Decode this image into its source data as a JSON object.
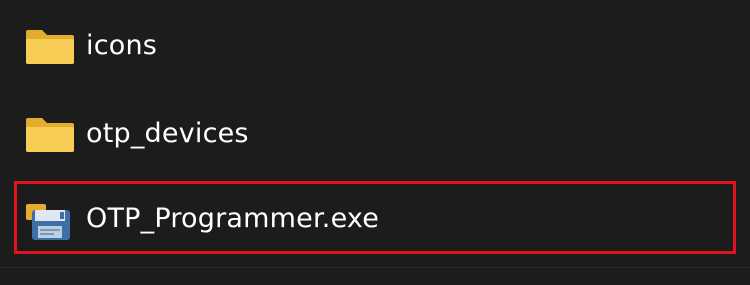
{
  "file_list": {
    "items": [
      {
        "name": "icons",
        "icon": "folder-icon"
      },
      {
        "name": "otp_devices",
        "icon": "folder-icon"
      },
      {
        "name": "OTP_Programmer.exe",
        "icon": "executable-app-icon"
      }
    ],
    "highlighted_item_index": 2
  },
  "colors": {
    "background": "#1c1c1c",
    "text": "#ffffff",
    "highlight_border": "#e0141c",
    "folder_yellow": "#f4c84a"
  }
}
